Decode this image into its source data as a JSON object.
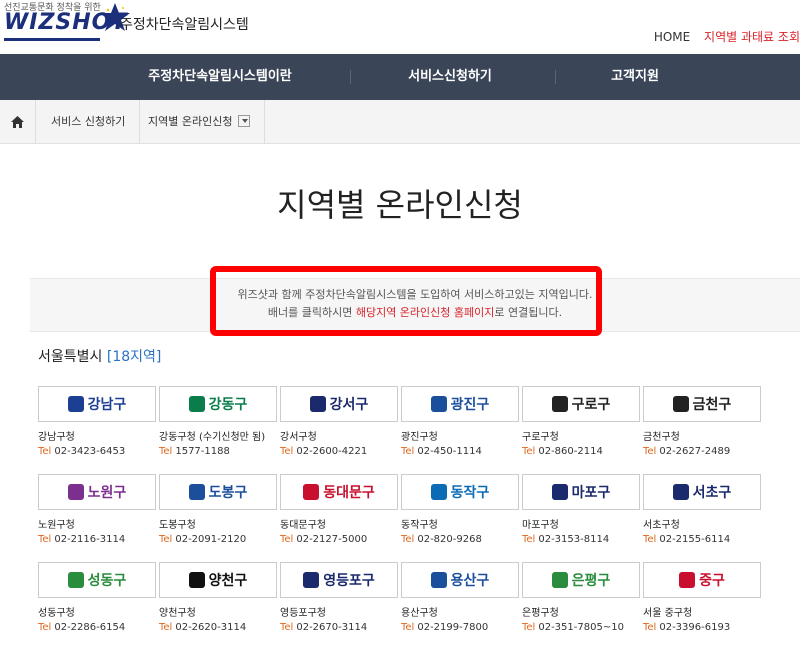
{
  "header": {
    "tagline": "선진교통문화 정착을 위한",
    "logo_word": "WIZSHOT",
    "system_name": "주정차단속알림시스템",
    "home_link": "HOME",
    "region_link": "지역별 과태료 조회"
  },
  "nav": {
    "items": [
      "주정차단속알림시스템이란",
      "서비스신청하기",
      "고객지원"
    ]
  },
  "breadcrumb": {
    "items": [
      "서비스 신청하기",
      "지역별 온라인신청"
    ]
  },
  "page_title": "지역별 온라인신청",
  "notice": {
    "line1": "위즈샷과 함께 주정차단속알림시스템을 도입하여 서비스하고있는 지역입니다.",
    "line2_prefix": "배너를 클릭하시면 ",
    "line2_highlight": "해당지역 온라인신청 홈페이지",
    "line2_suffix": "로 연결됩니다."
  },
  "section": {
    "title": "서울특별시",
    "count": "[18지역]"
  },
  "tel_label": "Tel",
  "districts": [
    {
      "banner": "강남구",
      "name": "강남구청",
      "tel": "02-3423-6453",
      "color": "#1c3f94"
    },
    {
      "banner": "강동구",
      "name": "강동구청 (수기신청만 됨)",
      "tel": "1577-1188",
      "color": "#0a7d4a"
    },
    {
      "banner": "강서구",
      "name": "강서구청",
      "tel": "02-2600-4221",
      "color": "#1a2a6c"
    },
    {
      "banner": "광진구",
      "name": "광진구청",
      "tel": "02-450-1114",
      "color": "#1b4f9c"
    },
    {
      "banner": "구로구",
      "name": "구로구청",
      "tel": "02-860-2114",
      "color": "#222222"
    },
    {
      "banner": "금천구",
      "name": "금천구청",
      "tel": "02-2627-2489",
      "color": "#222222"
    },
    {
      "banner": "노원구",
      "name": "노원구청",
      "tel": "02-2116-3114",
      "color": "#7b2f8e"
    },
    {
      "banner": "도봉구",
      "name": "도봉구청",
      "tel": "02-2091-2120",
      "color": "#1b4f9c"
    },
    {
      "banner": "동대문구",
      "name": "동대문구청",
      "tel": "02-2127-5000",
      "color": "#c8102e"
    },
    {
      "banner": "동작구",
      "name": "동작구청",
      "tel": "02-820-9268",
      "color": "#0c6bb5"
    },
    {
      "banner": "마포구",
      "name": "마포구청",
      "tel": "02-3153-8114",
      "color": "#1a2a6c"
    },
    {
      "banner": "서초구",
      "name": "서초구청",
      "tel": "02-2155-6114",
      "color": "#1a2a6c"
    },
    {
      "banner": "성동구",
      "name": "성동구청",
      "tel": "02-2286-6154",
      "color": "#2a8c3d"
    },
    {
      "banner": "양천구",
      "name": "양천구청",
      "tel": "02-2620-3114",
      "color": "#111111"
    },
    {
      "banner": "영등포구",
      "name": "영등포구청",
      "tel": "02-2670-3114",
      "color": "#1a2a6c"
    },
    {
      "banner": "용산구",
      "name": "용산구청",
      "tel": "02-2199-7800",
      "color": "#1b4f9c"
    },
    {
      "banner": "은평구",
      "name": "은평구청",
      "tel": "02-351-7805~10",
      "color": "#2a8c3d"
    },
    {
      "banner": "중구",
      "name": "서울 중구청",
      "tel": "02-3396-6193",
      "color": "#c8102e"
    }
  ]
}
